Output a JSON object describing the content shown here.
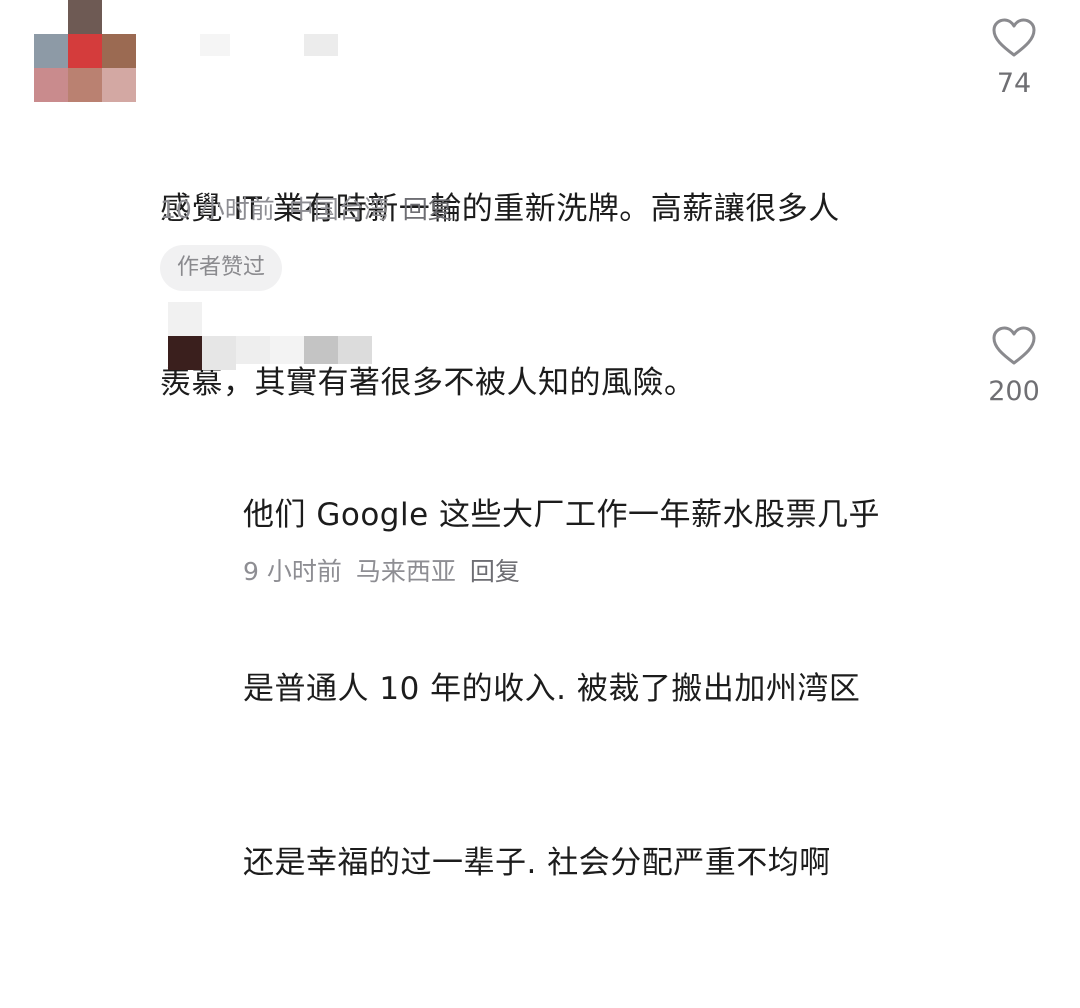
{
  "comments": [
    {
      "text_lines": [
        "感覺 IT 業有時新一輪的重新洗牌。高薪讓很多人",
        "羨慕，其實有著很多不被人知的風險。"
      ],
      "time": "10 小时前",
      "location": "中国台湾",
      "reply_label": "回复",
      "like_count": "74",
      "author_badge": "作者赞过"
    },
    {
      "text_lines": [
        "他们 Google 这些大厂工作一年薪水股票几乎",
        "是普通人 10 年的收入. 被裁了搬出加州湾区",
        "还是幸福的过一辈子. 社会分配严重不均啊"
      ],
      "time": "9 小时前",
      "location": "马来西亚",
      "reply_label": "回复",
      "like_count": "200"
    }
  ],
  "icons": {
    "like": "heart-outline-icon"
  },
  "colors": {
    "text": "#1c1c1c",
    "meta": "#8e8e93",
    "badge_bg": "#f1f1f2",
    "icon": "#8a8a8e"
  }
}
